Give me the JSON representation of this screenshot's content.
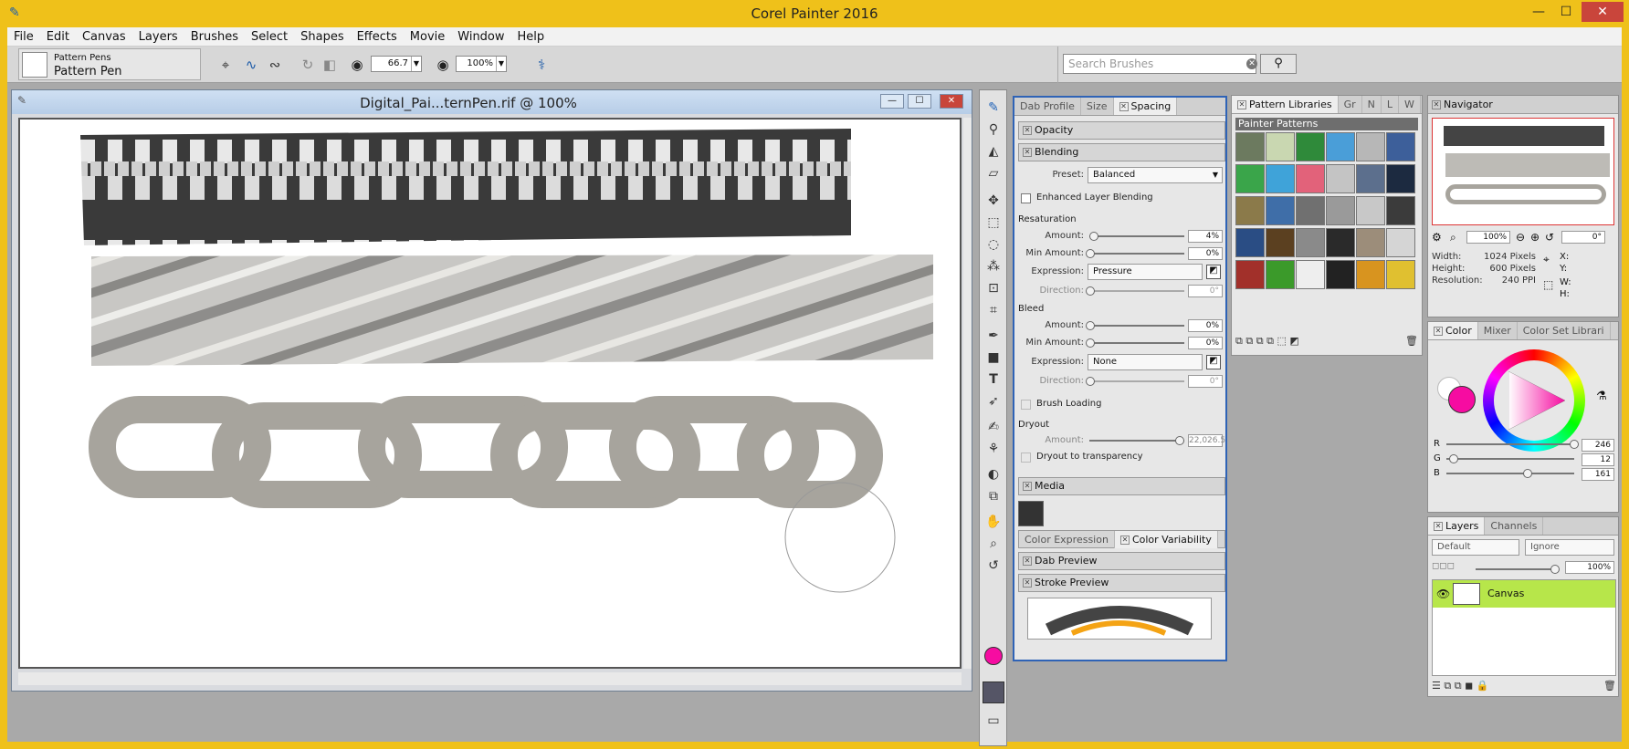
{
  "app": {
    "title": "Corel Painter 2016"
  },
  "window_controls": {
    "minimize": "—",
    "maximize": "☐",
    "close": "✕"
  },
  "menu": [
    "File",
    "Edit",
    "Canvas",
    "Layers",
    "Brushes",
    "Select",
    "Shapes",
    "Effects",
    "Movie",
    "Window",
    "Help"
  ],
  "property_bar": {
    "brush_category": "Pattern Pens",
    "brush_variant": "Pattern Pen",
    "size_value": "66.7",
    "opacity_value": "100%",
    "search_placeholder": "Search Brushes"
  },
  "document": {
    "title": "Digital_Pai...ternPen.rif @ 100%",
    "patterns": [
      "zipper",
      "rope",
      "chain"
    ]
  },
  "brush_controls": {
    "tabs": [
      "Dab Profile",
      "Size",
      "Spacing"
    ],
    "opacity_header": "Opacity",
    "blending_header": "Blending",
    "preset_label": "Preset:",
    "preset_value": "Balanced",
    "enhanced_layer_blending": "Enhanced Layer Blending",
    "resaturation_label": "Resaturation",
    "amount_label": "Amount:",
    "min_amount_label": "Min Amount:",
    "expression_label": "Expression:",
    "direction_label": "Direction:",
    "resat_amount": "4%",
    "resat_min": "0%",
    "resat_expression": "Pressure",
    "resat_direction": "0°",
    "bleed_label": "Bleed",
    "bleed_amount": "0%",
    "bleed_min": "0%",
    "bleed_expression": "None",
    "bleed_direction": "0°",
    "brush_loading": "Brush Loading",
    "dryout_label": "Dryout",
    "dryout_amount": "22,026.5",
    "dryout_transparency": "Dryout to transparency",
    "media_header": "Media",
    "color_tabs": [
      "Color Expression",
      "Color Variability"
    ],
    "dab_preview": "Dab Preview",
    "stroke_preview": "Stroke Preview"
  },
  "pattern_libraries": {
    "tabs": [
      "Pattern Libraries",
      "Gr",
      "N",
      "L",
      "W"
    ],
    "library_name": "Painter Patterns",
    "swatch_colors": [
      "#6c7a5f",
      "#c9d7b1",
      "#2f8a3a",
      "#4a9ed8",
      "#b7b7b7",
      "#3d5f9a",
      "#3aa54a",
      "#3fa3d9",
      "#e2627a",
      "#c4c4c4",
      "#5c6f8d",
      "#1c2a40",
      "#8b7a4a",
      "#3f6ea8",
      "#707070",
      "#9a9a9a",
      "#c8c8c8",
      "#3b3b3b",
      "#2a4d84",
      "#5b4020",
      "#8a8a8a",
      "#2a2a2a",
      "#9c8d7a",
      "#d5d5d5",
      "#a2302a",
      "#3b9a2a",
      "#eeeeee",
      "#222222",
      "#d8941f",
      "#e0c030"
    ]
  },
  "navigator": {
    "title": "Navigator",
    "zoom": "100%",
    "rotation": "0°",
    "width_label": "Width:",
    "width_value": "1024 Pixels",
    "height_label": "Height:",
    "height_value": "600 Pixels",
    "resolution_label": "Resolution:",
    "resolution_value": "240 PPI",
    "x_label": "X:",
    "y_label": "Y:",
    "w_label": "W:",
    "h_label": "H:"
  },
  "color_panel": {
    "tabs": [
      "Color",
      "Mixer",
      "Color Set Librari"
    ],
    "current_color": "#f60ca1",
    "r_label": "R",
    "g_label": "G",
    "b_label": "B",
    "r": "246",
    "g": "12",
    "b": "161"
  },
  "layers_panel": {
    "tabs": [
      "Layers",
      "Channels"
    ],
    "composite_method": "Default",
    "composite_depth": "Ignore",
    "opacity": "100%",
    "layer_name": "Canvas",
    "highlight_color": "#b7e64a"
  }
}
